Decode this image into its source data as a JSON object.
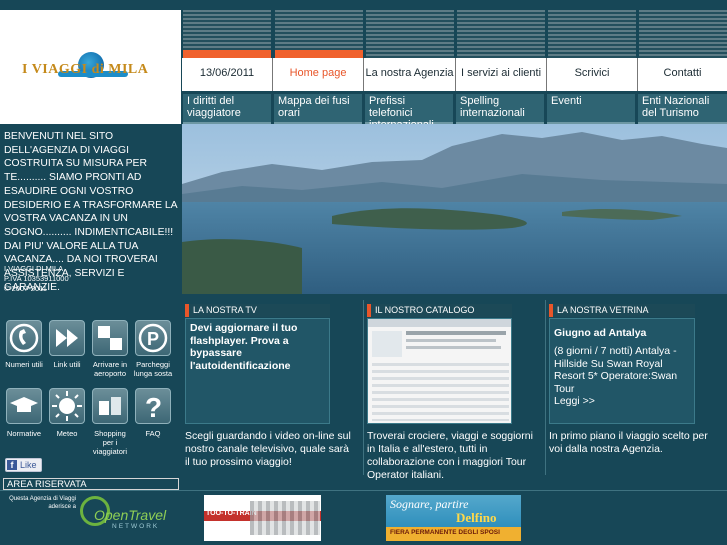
{
  "logo": {
    "text": "I VIAGGI di MILA"
  },
  "nav": {
    "date": "13/06/2011",
    "items": [
      "Home page",
      "La nostra Agenzia",
      "I servizi ai clienti",
      "Scrivici",
      "Contatti"
    ]
  },
  "submenu": [
    "I diritti del viaggiatore",
    "Mappa dei fusi orari",
    "Prefissi telefonici internazionali",
    "Spelling internazionali",
    "Eventi",
    "Enti Nazionali del Turismo"
  ],
  "welcome": "BENVENUTI NEL SITO DELL'AGENZIA DI VIAGGI COSTRUITA SU MISURA PER TE.......... SIAMO PRONTI AD ESAUDIRE OGNI VOSTRO DESIDERIO E A TRASFORMARE LA VOSTRA VACANZA IN UN SOGNO.......... INDIMENTICABILE!!! DAI PIU' VALORE ALLA TUA VACANZA.... DA NOI TROVERAI ASSISTENZA, SERVIZI E GARANZIE.",
  "company": {
    "name": "I VIAGGI DI MILA",
    "piva": "P.IVA 10353911000",
    "copyright": "© 2007-2011"
  },
  "icons": [
    {
      "icon": "phone-icon",
      "label": "Numeri utili"
    },
    {
      "icon": "fast-forward-icon",
      "label": "Link utili"
    },
    {
      "icon": "checker-icon",
      "label": "Arrivare in aeroporto"
    },
    {
      "icon": "parking-icon",
      "label": "Parcheggi lunga sosta"
    },
    {
      "icon": "graduation-cap-icon",
      "label": "Normative"
    },
    {
      "icon": "sun-icon",
      "label": "Meteo"
    },
    {
      "icon": "shopping-icon",
      "label": "Shopping per i viaggiatori"
    },
    {
      "icon": "question-icon",
      "label": "FAQ"
    }
  ],
  "like": "Like",
  "tv": {
    "header": "LA NOSTRA TV",
    "message": "Devi aggiornare il tuo flashplayer. Prova a bypassare l'autoidentificazione",
    "desc": "Scegli guardando i video on-line sul nostro canale televisivo, quale sarà il tuo prossimo viaggio!"
  },
  "catalogo": {
    "header": "IL NOSTRO CATALOGO",
    "desc": "Troverai crociere, viaggi e soggiorni in Italia e all'estero, tutti in collaborazione con i maggiori Tour Operator italiani."
  },
  "vetrina": {
    "header": "LA NOSTRA VETRINA",
    "title": "Giugno ad Antalya",
    "details": "(8 giorni / 7 notti) Antalya - Hillside Su Swan Royal Resort 5* Operatore:Swan Tour",
    "link": "Leggi >>",
    "desc": "In primo piano il viaggio scelto per voi dalla nostra Agenzia."
  },
  "area": "AREA RISERVATA",
  "opentravel": {
    "line": "Questa Agenzia di Viaggi aderisce a",
    "logo": "OpenTravel",
    "sub": "NETWORK"
  },
  "banners": {
    "train": "TOO-TO-TRAIN",
    "sposi_top": "Sognare, partire",
    "sposi_logo": "Delfino",
    "sposi_bottom": "FIERA PERMANENTE DEGLI SPOSI"
  },
  "colors": {
    "accent": "#f0612d",
    "background": "#174757",
    "submenu": "#2f6473"
  }
}
